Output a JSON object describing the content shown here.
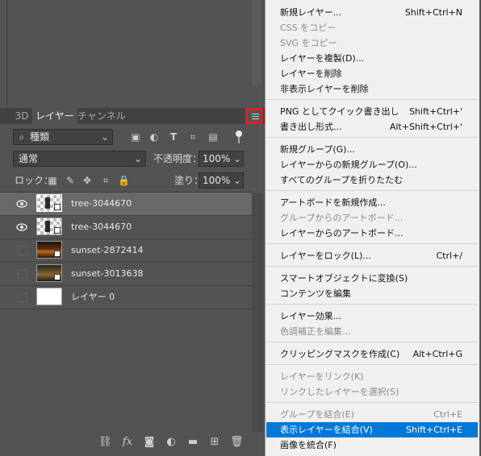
{
  "panel": {
    "tabs": [
      {
        "label": "3D"
      },
      {
        "label": "レイヤー"
      },
      {
        "label": "チャンネル"
      }
    ],
    "filter": {
      "kind_label": "種類"
    },
    "blend_mode": "通常",
    "opacity_label": "不透明度：",
    "opacity_value": "100%",
    "lock_label": "ロック：",
    "fill_label": "塗り：",
    "fill_value": "100%",
    "layers": [
      {
        "name": "tree-3044670",
        "visible": true,
        "selected": true
      },
      {
        "name": "tree-3044670",
        "visible": true,
        "selected": false
      },
      {
        "name": "sunset-2872414",
        "visible": false,
        "selected": false
      },
      {
        "name": "sunset-3013638",
        "visible": false,
        "selected": false
      },
      {
        "name": "レイヤー 0",
        "visible": false,
        "selected": false
      }
    ],
    "bottom_fx": "fx"
  },
  "menu": {
    "items": [
      {
        "label": "新規レイヤー...",
        "shortcut": "Shift+Ctrl+N",
        "disabled": false
      },
      {
        "label": "CSS をコピー",
        "shortcut": "",
        "disabled": true
      },
      {
        "label": "SVG をコピー",
        "shortcut": "",
        "disabled": true
      },
      {
        "label": "レイヤーを複製(D)...",
        "shortcut": "",
        "disabled": false
      },
      {
        "label": "レイヤーを削除",
        "shortcut": "",
        "disabled": false
      },
      {
        "label": "非表示レイヤーを削除",
        "shortcut": "",
        "disabled": false
      },
      {
        "label": "PNG としてクイック書き出し",
        "shortcut": "Shift+Ctrl+'",
        "disabled": false
      },
      {
        "label": "書き出し形式...",
        "shortcut": "Alt+Shift+Ctrl+'",
        "disabled": false
      },
      {
        "label": "新規グループ(G)...",
        "shortcut": "",
        "disabled": false
      },
      {
        "label": "レイヤーからの新規グループ(O)...",
        "shortcut": "",
        "disabled": false
      },
      {
        "label": "すべてのグループを折りたたむ",
        "shortcut": "",
        "disabled": false
      },
      {
        "label": "アートボードを新規作成...",
        "shortcut": "",
        "disabled": false
      },
      {
        "label": "グループからのアートボード...",
        "shortcut": "",
        "disabled": true
      },
      {
        "label": "レイヤーからのアートボード...",
        "shortcut": "",
        "disabled": false
      },
      {
        "label": "レイヤーをロック(L)...",
        "shortcut": "Ctrl+/",
        "disabled": false
      },
      {
        "label": "スマートオブジェクトに変換(S)",
        "shortcut": "",
        "disabled": false
      },
      {
        "label": "コンテンツを編集",
        "shortcut": "",
        "disabled": false
      },
      {
        "label": "レイヤー効果...",
        "shortcut": "",
        "disabled": false
      },
      {
        "label": "色調補正を編集...",
        "shortcut": "",
        "disabled": true
      },
      {
        "label": "クリッピングマスクを作成(C)",
        "shortcut": "Alt+Ctrl+G",
        "disabled": false
      },
      {
        "label": "レイヤーをリンク(K)",
        "shortcut": "",
        "disabled": true
      },
      {
        "label": "リンクしたレイヤーを選択(S)",
        "shortcut": "",
        "disabled": true
      },
      {
        "label": "グループを結合(E)",
        "shortcut": "Ctrl+E",
        "disabled": true
      },
      {
        "label": "表示レイヤーを結合(V)",
        "shortcut": "Shift+Ctrl+E",
        "disabled": false,
        "highlighted": true
      },
      {
        "label": "画像を統合(F)",
        "shortcut": "",
        "disabled": false
      }
    ]
  },
  "colors": {
    "highlight": "#0078d7",
    "panel_bg": "#535353",
    "menu_bg": "#f0f0f0",
    "callout": "#e41d23"
  }
}
